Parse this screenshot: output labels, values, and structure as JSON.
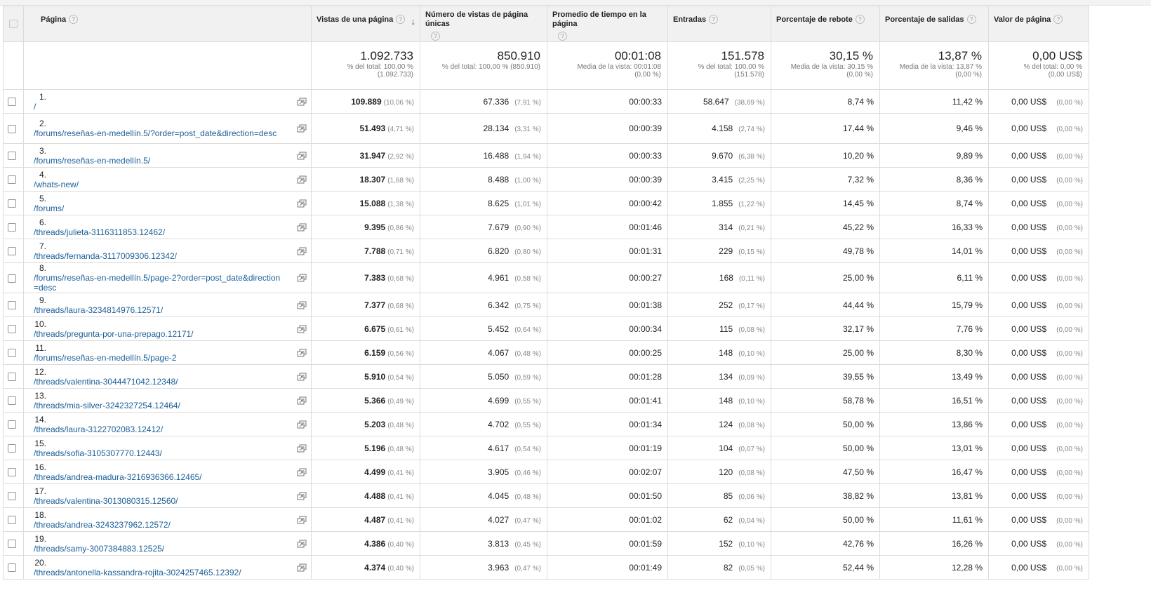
{
  "columns": {
    "page": "Página",
    "pageviews": "Vistas de una página",
    "unique_pageviews": "Número de vistas de página únicas",
    "avg_time": "Promedio de tiempo en la página",
    "entrances": "Entradas",
    "bounce_rate": "Porcentaje de rebote",
    "exit_rate": "Porcentaje de salidas",
    "page_value": "Valor de página"
  },
  "help_glyph": "?",
  "sort_glyph": "↓",
  "totals": {
    "pageviews": {
      "value": "1.092.733",
      "sub1": "% del total: 100,00 %",
      "sub2": "(1.092.733)"
    },
    "unique_pageviews": {
      "value": "850.910",
      "sub1": "% del total: 100,00 % (850.910)",
      "sub2": ""
    },
    "avg_time": {
      "value": "00:01:08",
      "sub1": "Media de la vista: 00:01:08",
      "sub2": "(0,00 %)"
    },
    "entrances": {
      "value": "151.578",
      "sub1": "% del total: 100,00 %",
      "sub2": "(151.578)"
    },
    "bounce_rate": {
      "value": "30,15 %",
      "sub1": "Media de la vista: 30,15 %",
      "sub2": "(0,00 %)"
    },
    "exit_rate": {
      "value": "13,87 %",
      "sub1": "Media de la vista: 13,87 %",
      "sub2": "(0,00 %)"
    },
    "page_value": {
      "value": "0,00 US$",
      "sub1": "% del total: 0,00 %",
      "sub2": "(0,00 US$)"
    }
  },
  "rows": [
    {
      "idx": "1.",
      "page": "/",
      "pv": "109.889",
      "pv_pct": "(10,06 %)",
      "upv": "67.336",
      "upv_pct": "(7,91 %)",
      "time": "00:00:33",
      "ent": "58.647",
      "ent_pct": "(38,69 %)",
      "bounce": "8,74 %",
      "exit": "11,42 %",
      "value": "0,00 US$",
      "value_pct": "(0,00 %)"
    },
    {
      "idx": "2.",
      "page": "/forums/reseñas-en-medellín.5/?order=post_date&direction=desc",
      "pv": "51.493",
      "pv_pct": "(4,71 %)",
      "upv": "28.134",
      "upv_pct": "(3,31 %)",
      "time": "00:00:39",
      "ent": "4.158",
      "ent_pct": "(2,74 %)",
      "bounce": "17,44 %",
      "exit": "9,46 %",
      "value": "0,00 US$",
      "value_pct": "(0,00 %)"
    },
    {
      "idx": "3.",
      "page": "/forums/reseñas-en-medellín.5/",
      "pv": "31.947",
      "pv_pct": "(2,92 %)",
      "upv": "16.488",
      "upv_pct": "(1,94 %)",
      "time": "00:00:33",
      "ent": "9.670",
      "ent_pct": "(6,38 %)",
      "bounce": "10,20 %",
      "exit": "9,89 %",
      "value": "0,00 US$",
      "value_pct": "(0,00 %)"
    },
    {
      "idx": "4.",
      "page": "/whats-new/",
      "pv": "18.307",
      "pv_pct": "(1,68 %)",
      "upv": "8.488",
      "upv_pct": "(1,00 %)",
      "time": "00:00:39",
      "ent": "3.415",
      "ent_pct": "(2,25 %)",
      "bounce": "7,32 %",
      "exit": "8,36 %",
      "value": "0,00 US$",
      "value_pct": "(0,00 %)"
    },
    {
      "idx": "5.",
      "page": "/forums/",
      "pv": "15.088",
      "pv_pct": "(1,38 %)",
      "upv": "8.625",
      "upv_pct": "(1,01 %)",
      "time": "00:00:42",
      "ent": "1.855",
      "ent_pct": "(1,22 %)",
      "bounce": "14,45 %",
      "exit": "8,74 %",
      "value": "0,00 US$",
      "value_pct": "(0,00 %)"
    },
    {
      "idx": "6.",
      "page": "/threads/julieta-3116311853.12462/",
      "pv": "9.395",
      "pv_pct": "(0,86 %)",
      "upv": "7.679",
      "upv_pct": "(0,90 %)",
      "time": "00:01:46",
      "ent": "314",
      "ent_pct": "(0,21 %)",
      "bounce": "45,22 %",
      "exit": "16,33 %",
      "value": "0,00 US$",
      "value_pct": "(0,00 %)"
    },
    {
      "idx": "7.",
      "page": "/threads/fernanda-3117009306.12342/",
      "pv": "7.788",
      "pv_pct": "(0,71 %)",
      "upv": "6.820",
      "upv_pct": "(0,80 %)",
      "time": "00:01:31",
      "ent": "229",
      "ent_pct": "(0,15 %)",
      "bounce": "49,78 %",
      "exit": "14,01 %",
      "value": "0,00 US$",
      "value_pct": "(0,00 %)"
    },
    {
      "idx": "8.",
      "page": "/forums/reseñas-en-medellín.5/page-2?order=post_date&direction=desc",
      "pv": "7.383",
      "pv_pct": "(0,68 %)",
      "upv": "4.961",
      "upv_pct": "(0,58 %)",
      "time": "00:00:27",
      "ent": "168",
      "ent_pct": "(0,11 %)",
      "bounce": "25,00 %",
      "exit": "6,11 %",
      "value": "0,00 US$",
      "value_pct": "(0,00 %)"
    },
    {
      "idx": "9.",
      "page": "/threads/laura-3234814976.12571/",
      "pv": "7.377",
      "pv_pct": "(0,68 %)",
      "upv": "6.342",
      "upv_pct": "(0,75 %)",
      "time": "00:01:38",
      "ent": "252",
      "ent_pct": "(0,17 %)",
      "bounce": "44,44 %",
      "exit": "15,79 %",
      "value": "0,00 US$",
      "value_pct": "(0,00 %)"
    },
    {
      "idx": "10.",
      "page": "/threads/pregunta-por-una-prepago.12171/",
      "pv": "6.675",
      "pv_pct": "(0,61 %)",
      "upv": "5.452",
      "upv_pct": "(0,64 %)",
      "time": "00:00:34",
      "ent": "115",
      "ent_pct": "(0,08 %)",
      "bounce": "32,17 %",
      "exit": "7,76 %",
      "value": "0,00 US$",
      "value_pct": "(0,00 %)"
    },
    {
      "idx": "11.",
      "page": "/forums/reseñas-en-medellín.5/page-2",
      "pv": "6.159",
      "pv_pct": "(0,56 %)",
      "upv": "4.067",
      "upv_pct": "(0,48 %)",
      "time": "00:00:25",
      "ent": "148",
      "ent_pct": "(0,10 %)",
      "bounce": "25,00 %",
      "exit": "8,30 %",
      "value": "0,00 US$",
      "value_pct": "(0,00 %)"
    },
    {
      "idx": "12.",
      "page": "/threads/valentina-3044471042.12348/",
      "pv": "5.910",
      "pv_pct": "(0,54 %)",
      "upv": "5.050",
      "upv_pct": "(0,59 %)",
      "time": "00:01:28",
      "ent": "134",
      "ent_pct": "(0,09 %)",
      "bounce": "39,55 %",
      "exit": "13,49 %",
      "value": "0,00 US$",
      "value_pct": "(0,00 %)"
    },
    {
      "idx": "13.",
      "page": "/threads/mia-silver-3242327254.12464/",
      "pv": "5.366",
      "pv_pct": "(0,49 %)",
      "upv": "4.699",
      "upv_pct": "(0,55 %)",
      "time": "00:01:41",
      "ent": "148",
      "ent_pct": "(0,10 %)",
      "bounce": "58,78 %",
      "exit": "16,51 %",
      "value": "0,00 US$",
      "value_pct": "(0,00 %)"
    },
    {
      "idx": "14.",
      "page": "/threads/laura-3122702083.12412/",
      "pv": "5.203",
      "pv_pct": "(0,48 %)",
      "upv": "4.702",
      "upv_pct": "(0,55 %)",
      "time": "00:01:34",
      "ent": "124",
      "ent_pct": "(0,08 %)",
      "bounce": "50,00 %",
      "exit": "13,86 %",
      "value": "0,00 US$",
      "value_pct": "(0,00 %)"
    },
    {
      "idx": "15.",
      "page": "/threads/sofia-3105307770.12443/",
      "pv": "5.196",
      "pv_pct": "(0,48 %)",
      "upv": "4.617",
      "upv_pct": "(0,54 %)",
      "time": "00:01:19",
      "ent": "104",
      "ent_pct": "(0,07 %)",
      "bounce": "50,00 %",
      "exit": "13,01 %",
      "value": "0,00 US$",
      "value_pct": "(0,00 %)"
    },
    {
      "idx": "16.",
      "page": "/threads/andrea-madura-3216936366.12465/",
      "pv": "4.499",
      "pv_pct": "(0,41 %)",
      "upv": "3.905",
      "upv_pct": "(0,46 %)",
      "time": "00:02:07",
      "ent": "120",
      "ent_pct": "(0,08 %)",
      "bounce": "47,50 %",
      "exit": "16,47 %",
      "value": "0,00 US$",
      "value_pct": "(0,00 %)"
    },
    {
      "idx": "17.",
      "page": "/threads/valentina-3013080315.12560/",
      "pv": "4.488",
      "pv_pct": "(0,41 %)",
      "upv": "4.045",
      "upv_pct": "(0,48 %)",
      "time": "00:01:50",
      "ent": "85",
      "ent_pct": "(0,06 %)",
      "bounce": "38,82 %",
      "exit": "13,81 %",
      "value": "0,00 US$",
      "value_pct": "(0,00 %)"
    },
    {
      "idx": "18.",
      "page": "/threads/andrea-3243237962.12572/",
      "pv": "4.487",
      "pv_pct": "(0,41 %)",
      "upv": "4.027",
      "upv_pct": "(0,47 %)",
      "time": "00:01:02",
      "ent": "62",
      "ent_pct": "(0,04 %)",
      "bounce": "50,00 %",
      "exit": "11,61 %",
      "value": "0,00 US$",
      "value_pct": "(0,00 %)"
    },
    {
      "idx": "19.",
      "page": "/threads/samy-3007384883.12525/",
      "pv": "4.386",
      "pv_pct": "(0,40 %)",
      "upv": "3.813",
      "upv_pct": "(0,45 %)",
      "time": "00:01:59",
      "ent": "152",
      "ent_pct": "(0,10 %)",
      "bounce": "42,76 %",
      "exit": "16,26 %",
      "value": "0,00 US$",
      "value_pct": "(0,00 %)"
    },
    {
      "idx": "20.",
      "page": "/threads/antonella-kassandra-rojita-3024257465.12392/",
      "pv": "4.374",
      "pv_pct": "(0,40 %)",
      "upv": "3.963",
      "upv_pct": "(0,47 %)",
      "time": "00:01:49",
      "ent": "82",
      "ent_pct": "(0,05 %)",
      "bounce": "52,44 %",
      "exit": "12,28 %",
      "value": "0,00 US$",
      "value_pct": "(0,00 %)"
    }
  ]
}
